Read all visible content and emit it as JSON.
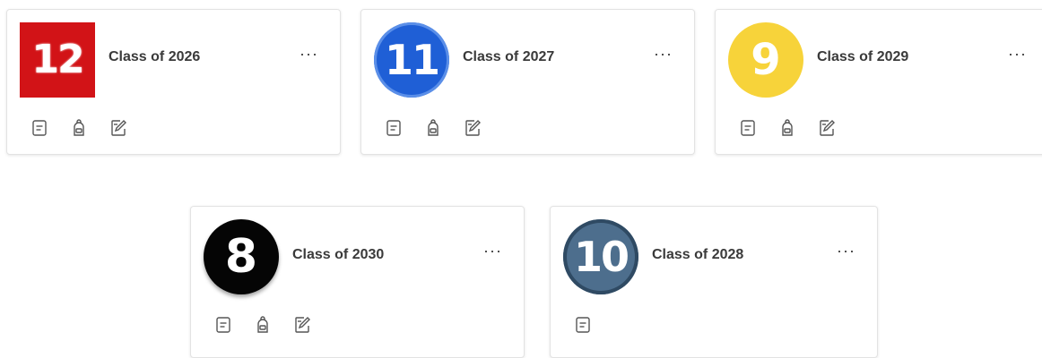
{
  "more_label": "···",
  "cards": [
    {
      "id": "2026",
      "title": "Class of 2026",
      "logo_text": "12",
      "logo_color": "#d21317",
      "icons": [
        "notes-icon",
        "backpack-icon",
        "assignment-edit-icon"
      ]
    },
    {
      "id": "2027",
      "title": "Class of 2027",
      "logo_text": "11",
      "logo_color": "#1f5fd6",
      "icons": [
        "notes-icon",
        "backpack-icon",
        "assignment-edit-icon"
      ]
    },
    {
      "id": "2029",
      "title": "Class of 2029",
      "logo_text": "9",
      "logo_color": "#f7d33a",
      "icons": [
        "notes-icon",
        "backpack-icon",
        "assignment-edit-icon"
      ]
    },
    {
      "id": "2030",
      "title": "Class of 2030",
      "logo_text": "8",
      "logo_color": "#050505",
      "icons": [
        "notes-icon",
        "backpack-icon",
        "assignment-edit-icon"
      ]
    },
    {
      "id": "2028",
      "title": "Class of 2028",
      "logo_text": "10",
      "logo_color": "#4d6e8d",
      "icons": [
        "notes-icon"
      ]
    }
  ]
}
